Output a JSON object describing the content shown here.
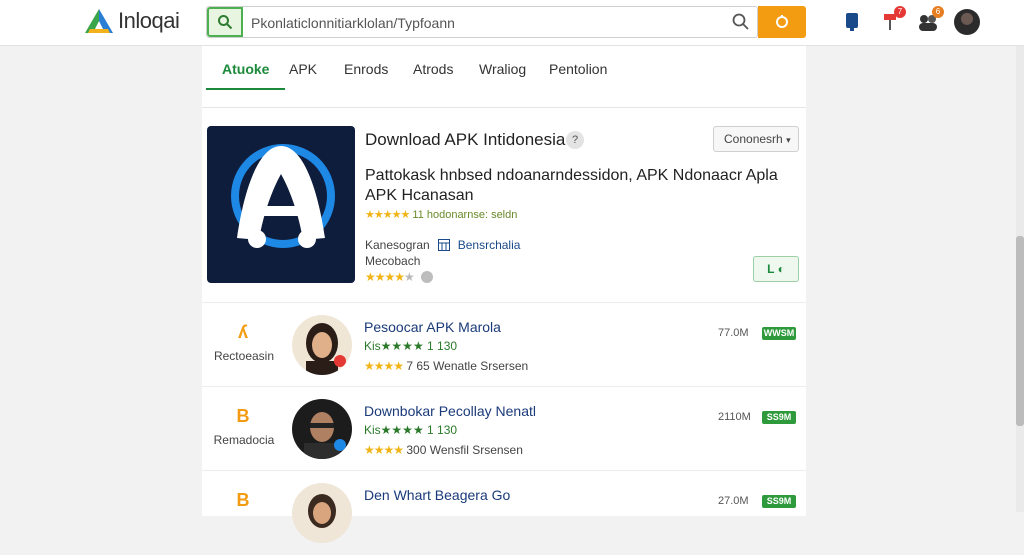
{
  "brand": {
    "name": "Inloqai"
  },
  "search": {
    "value": "Pkonlaticlonnitiarklolan/Typfoann",
    "placeholder": ""
  },
  "tabs": [
    {
      "label": "Atuoke",
      "active": true
    },
    {
      "label": "APK"
    },
    {
      "label": "Enrods"
    },
    {
      "label": "Atrods"
    },
    {
      "label": "Wraliog"
    },
    {
      "label": "Pentolion"
    }
  ],
  "featured": {
    "title": "Download APK Intidonesia",
    "info": "?",
    "select_label": "Cononesrh",
    "description": "Pattokask hnbsed ndoanarndessidon, APK Ndonaacr Apla APK Hcanasan",
    "stars": "★★★★★",
    "rating_text": "11 hodonarnse: seldn",
    "meta_label": "Kanesogran",
    "meta_link": "Bensrchalia",
    "meta_sub": "Mecobach",
    "meta_stars": "★★★★",
    "meta_stars_muted": "★",
    "action_label": "L ◐"
  },
  "rows": [
    {
      "left_icon": "ʎ",
      "left_label": "Rectoeasin",
      "title": "Pesoocar APK Marola",
      "rating": "Kis★★★★ 1 130",
      "stars": "★★★★",
      "sub": "7 65 Wenatle  Srsersen",
      "size": "77.0M",
      "badge": "WWSM"
    },
    {
      "left_icon": "B",
      "left_label": "Remadocia",
      "title": "Downbokar Pecollay  Nenatl",
      "rating": "Kis★★★★ 1 130",
      "stars": "★★★★",
      "sub": "300 Wensfil  Srsensen",
      "size": "2110M",
      "badge": "SS9M"
    },
    {
      "left_icon": "B",
      "left_label": "",
      "title": "Den Whart Beagera  Go",
      "rating": "",
      "stars": "",
      "sub": "",
      "size": "27.0M",
      "badge": "SS9M"
    }
  ],
  "colors": {
    "accent": "#1b8a3a",
    "search_button": "#f39c12",
    "badge": "#2e9a3c"
  }
}
